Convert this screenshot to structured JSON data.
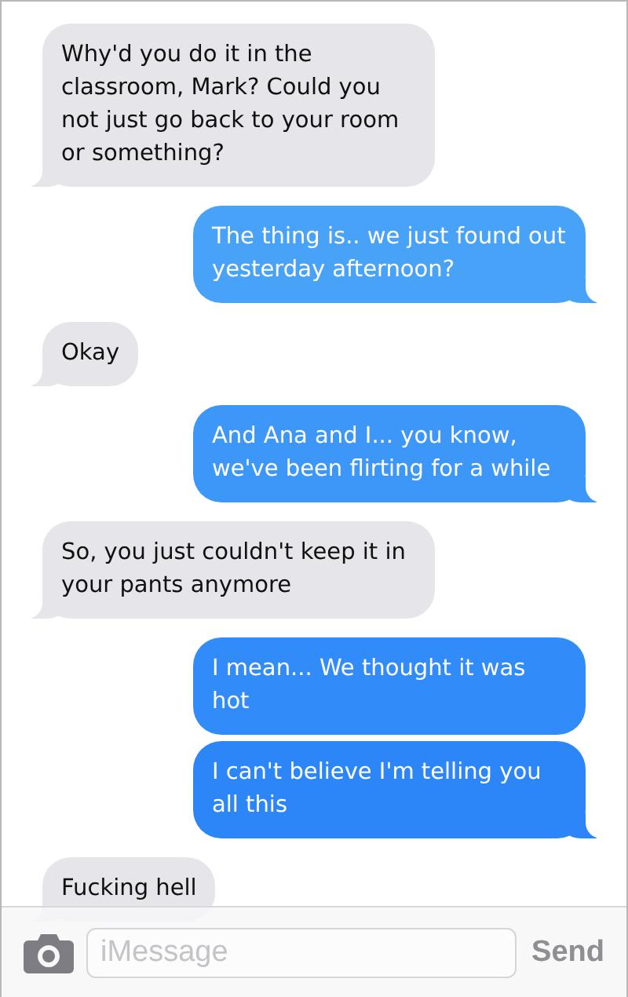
{
  "messages": [
    {
      "kind": "incoming",
      "text": "Why'd you do it in the classroom, Mark? Could you not just go back to your room or something?"
    },
    {
      "kind": "outgoing",
      "text": "The thing is.. we just found out yesterday afternoon?"
    },
    {
      "kind": "incoming",
      "text": "Okay"
    },
    {
      "kind": "outgoing",
      "text": "And Ana and I... you know, we've been flirting for a while"
    },
    {
      "kind": "incoming",
      "text": "So, you just couldn't keep it in your pants anymore"
    },
    {
      "kind": "outgoing",
      "text": "I mean... We thought it was hot"
    },
    {
      "kind": "outgoing",
      "text": "I can't believe I'm telling you all this"
    },
    {
      "kind": "incoming",
      "text": "Fucking hell"
    }
  ],
  "composer": {
    "placeholder": "iMessage",
    "send": "Send"
  }
}
